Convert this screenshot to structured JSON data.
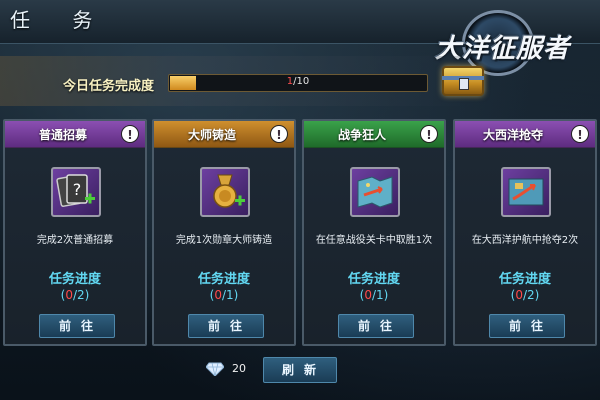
{
  "header": {
    "title": "任 务",
    "logo_text": "大洋征服者"
  },
  "daily_progress": {
    "label": "今日任务完成度",
    "current": "1",
    "total": "/10",
    "fill_fraction": 0.1
  },
  "colors": {
    "purple_head": "#7a3f9e",
    "orange_head": "#b9781f",
    "green_head": "#2f8a3d",
    "progress_cyan": "#62d8f2",
    "progress_red": "#ff4b4b"
  },
  "cards": [
    {
      "title": "普通招募",
      "head_color": "#7a3f9e",
      "icon": "recruit-card-icon",
      "description": "完成2次普通招募",
      "progress_label": "任务进度",
      "progress_open": "(",
      "progress_current": "0",
      "progress_total": "/2)",
      "button_label": "前往"
    },
    {
      "title": "大师铸造",
      "head_color": "#b9781f",
      "icon": "medal-forge-icon",
      "description": "完成1次勋章大师铸造",
      "progress_label": "任务进度",
      "progress_open": "(",
      "progress_current": "0",
      "progress_total": "/1)",
      "button_label": "前往"
    },
    {
      "title": "战争狂人",
      "head_color": "#2f8a3d",
      "icon": "battle-map-icon",
      "description": "在任意战役关卡中取胜1次",
      "progress_label": "任务进度",
      "progress_open": "(",
      "progress_current": "0",
      "progress_total": "/1)",
      "button_label": "前往"
    },
    {
      "title": "大西洋抢夺",
      "head_color": "#7a3f9e",
      "icon": "atlantic-plunder-icon",
      "description": "在大西洋护航中抢夺2次",
      "progress_label": "任务进度",
      "progress_open": "(",
      "progress_current": "0",
      "progress_total": "/2)",
      "button_label": "前往"
    }
  ],
  "footer": {
    "diamond_icon": "diamond-icon",
    "diamond_cost": "20",
    "refresh_label": "刷新"
  }
}
